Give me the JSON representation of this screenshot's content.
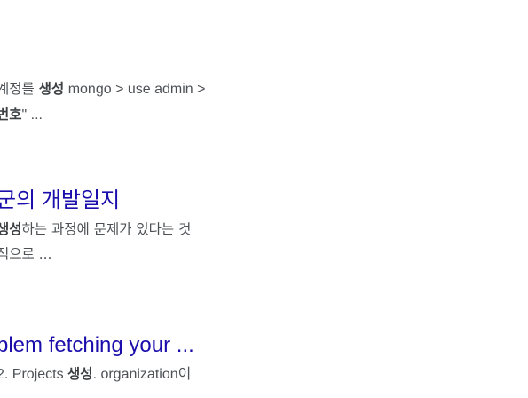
{
  "results": [
    {
      "title": "",
      "snippet_lines": [
        {
          "pre": "계정를 ",
          "bold": "생성",
          "post": " mongo > use admin >"
        },
        {
          "pre": "",
          "bold": "번호",
          "post": "\" ..."
        }
      ]
    },
    {
      "title": "군의 개발일지",
      "snippet_lines": [
        {
          "pre": "",
          "bold": "생성",
          "post": "하는 과정에 문제가 있다는 것"
        },
        {
          "pre": "적으로 ...",
          "bold": "",
          "post": ""
        }
      ]
    },
    {
      "title": "blem fetching your ...",
      "snippet_lines": [
        {
          "pre": " 2. Projects ",
          "bold": "생성",
          "post": ". organization이"
        }
      ]
    }
  ],
  "colors": {
    "link": "#1a0dab",
    "snippet": "#4d5156"
  }
}
